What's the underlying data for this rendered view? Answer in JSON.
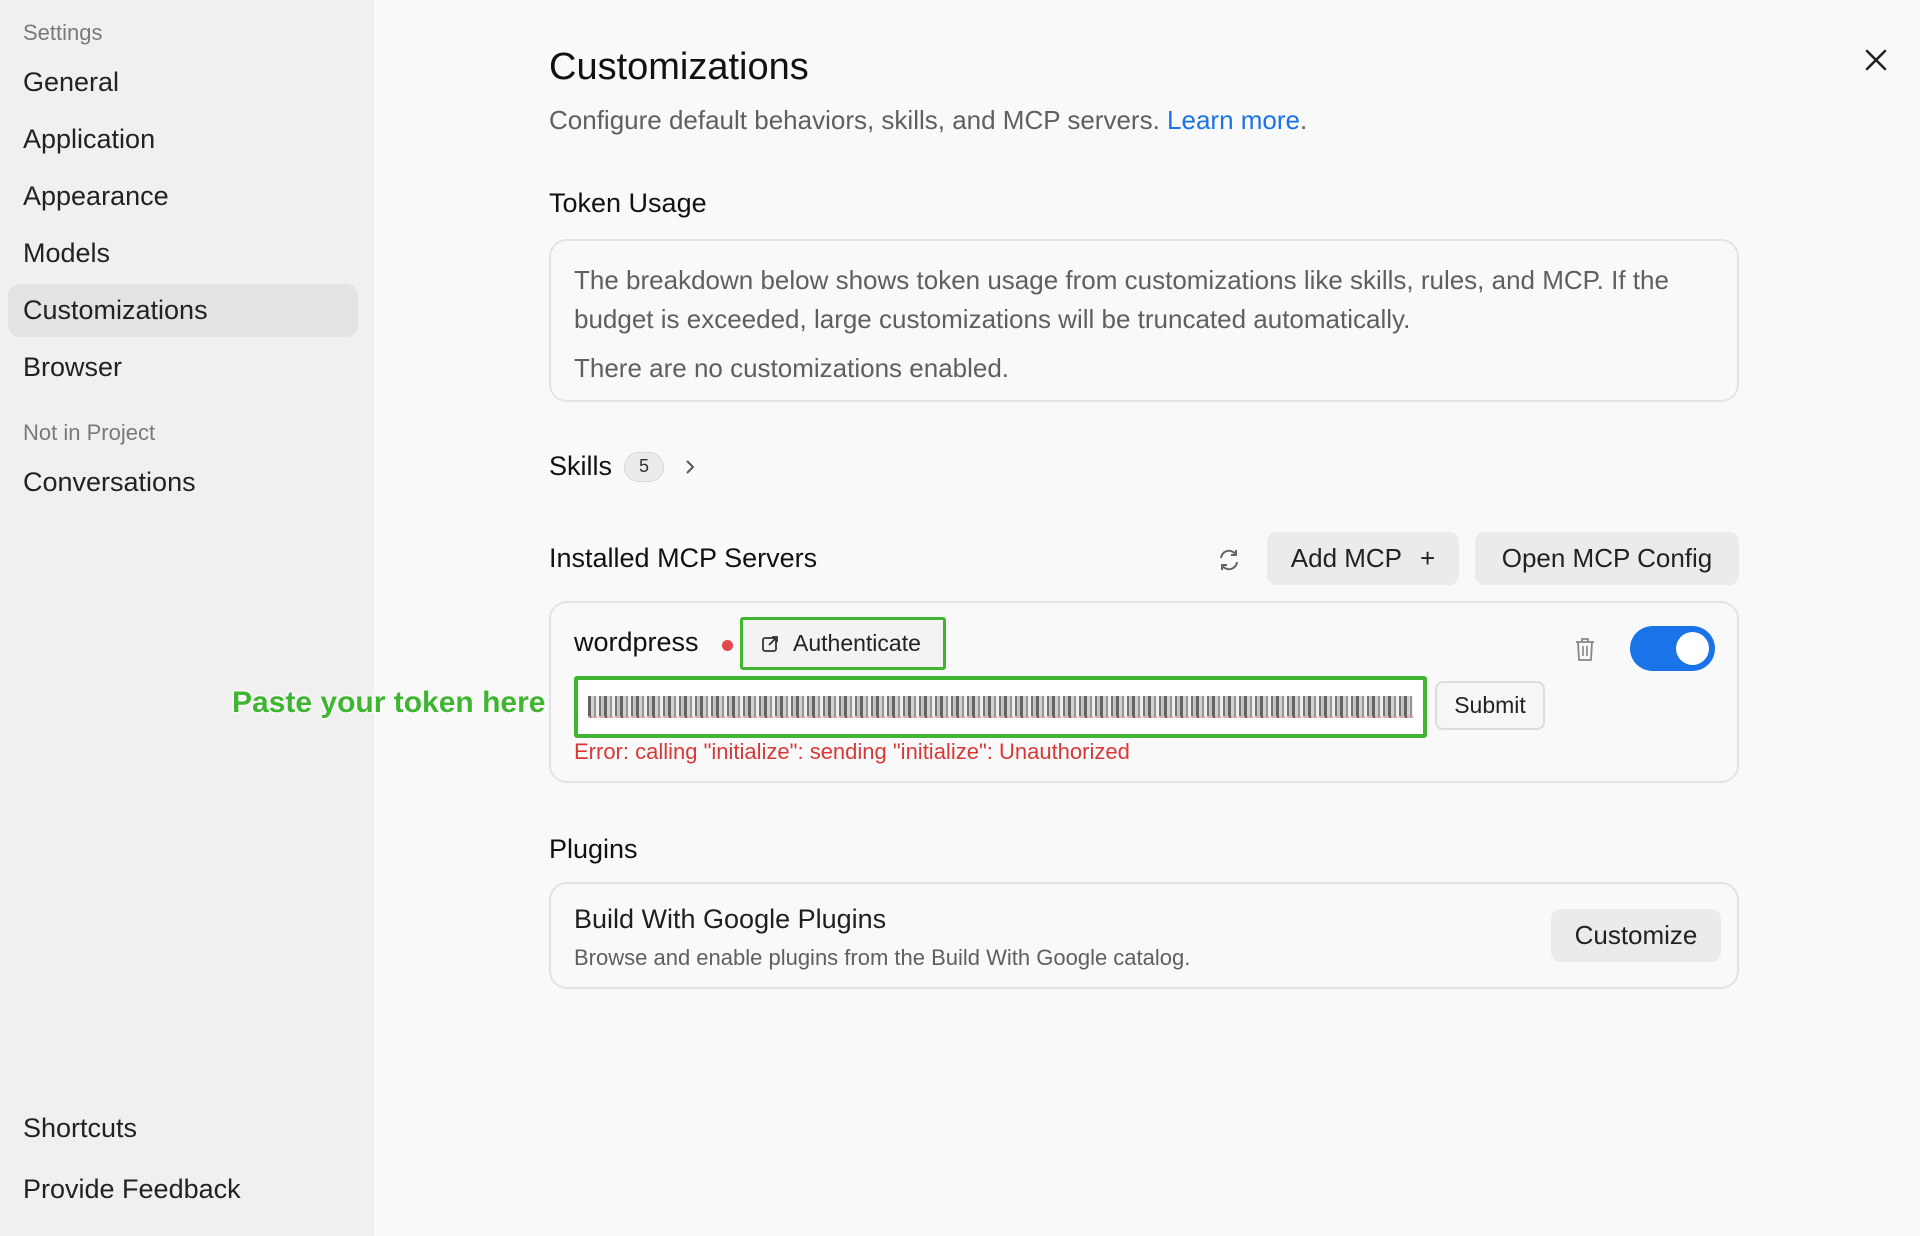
{
  "sidebar": {
    "section_settings": "Settings",
    "items": [
      {
        "label": "General"
      },
      {
        "label": "Application"
      },
      {
        "label": "Appearance"
      },
      {
        "label": "Models"
      },
      {
        "label": "Customizations",
        "active": true
      },
      {
        "label": "Browser"
      }
    ],
    "section_project": "Not in Project",
    "project_items": [
      {
        "label": "Conversations"
      }
    ],
    "bottom_items": [
      {
        "label": "Shortcuts"
      },
      {
        "label": "Provide Feedback"
      }
    ]
  },
  "main": {
    "title": "Customizations",
    "subtitle": "Configure default behaviors, skills, and MCP servers.",
    "learn_more": "Learn more",
    "subtitle_end": ".",
    "token_usage": {
      "heading": "Token Usage",
      "description": "The breakdown below shows token usage from customizations like skills, rules, and MCP. If the budget is exceeded, large customizations will be truncated automatically.",
      "empty": "There are no customizations enabled."
    },
    "skills": {
      "label": "Skills",
      "count": "5"
    },
    "mcp": {
      "heading": "Installed MCP Servers",
      "add_label": "Add MCP",
      "add_plus": "+",
      "open_config": "Open MCP Config",
      "server": {
        "name": "wordpress",
        "status_color": "#e0484e",
        "authenticate": "Authenticate",
        "enabled": true,
        "submit": "Submit",
        "error": "Error: calling \"initialize\": sending \"initialize\": Unauthorized"
      }
    },
    "annotation": "Paste your token here",
    "plugins": {
      "heading": "Plugins",
      "title": "Build With Google Plugins",
      "description": "Browse and enable plugins from the Build With Google catalog.",
      "customize": "Customize"
    }
  },
  "colors": {
    "accent": "#1a73e8",
    "highlight": "#3fb531",
    "error": "#d93838"
  }
}
